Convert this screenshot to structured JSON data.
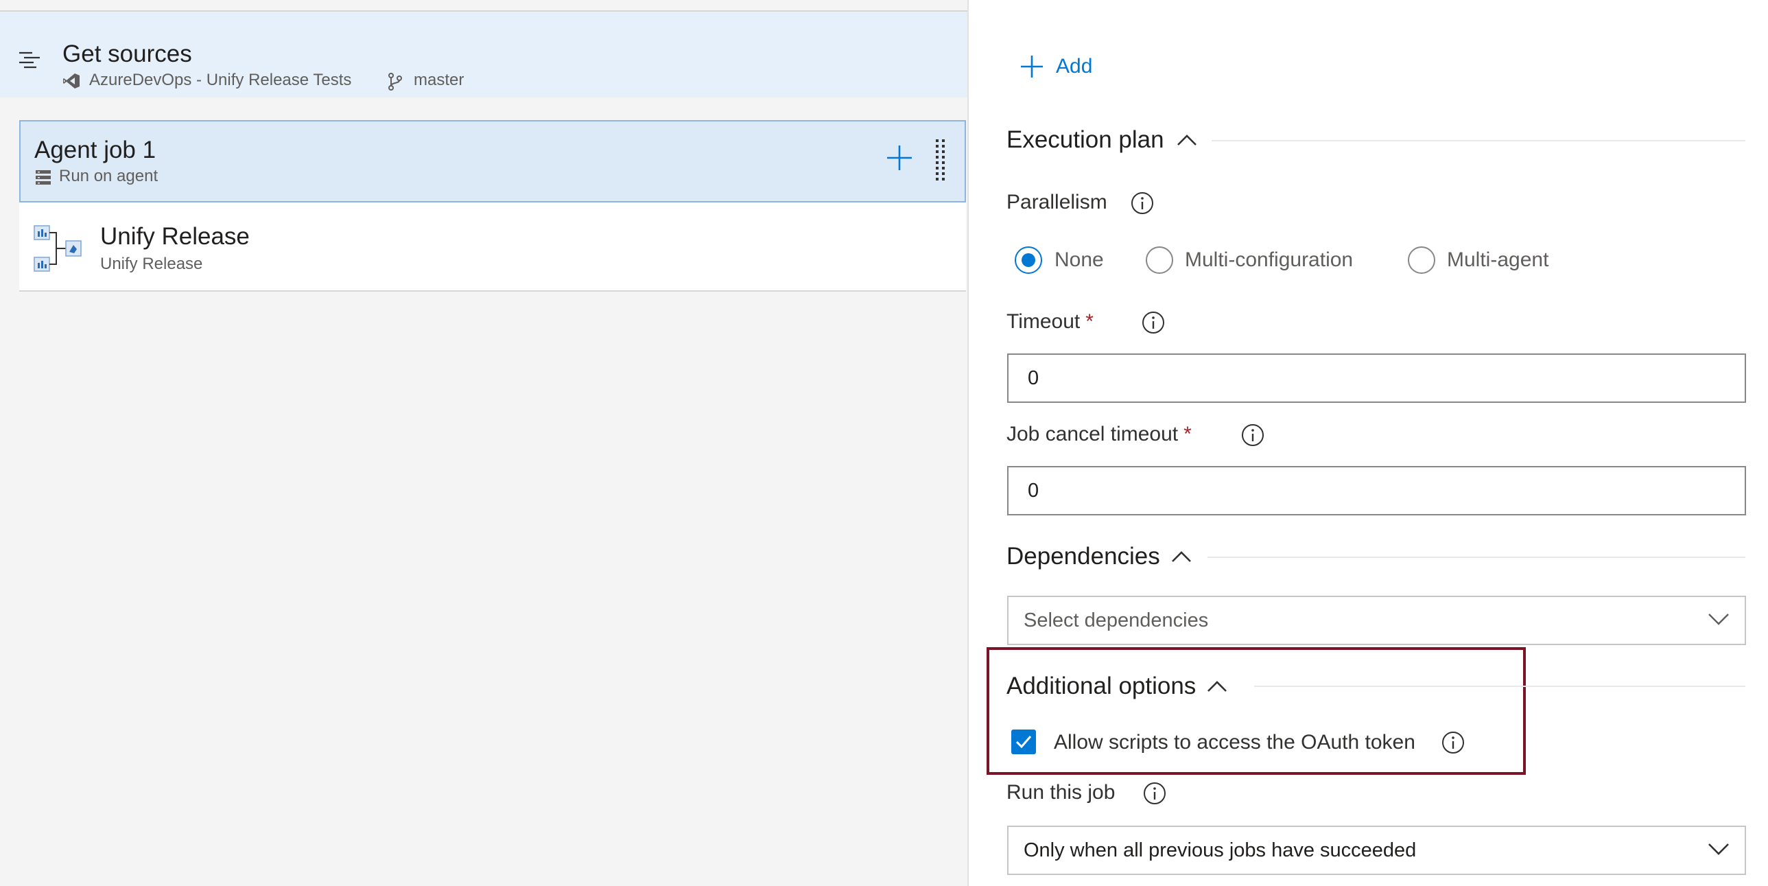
{
  "pipeline": {
    "get_sources": {
      "title": "Get sources",
      "repo": "AzureDevOps - Unify Release Tests",
      "branch": "master"
    },
    "agent_job": {
      "title": "Agent job 1",
      "subtitle": "Run on agent"
    },
    "task": {
      "title": "Unify Release",
      "subtitle": "Unify Release"
    }
  },
  "panel": {
    "add_label": "Add",
    "execution_plan": {
      "title": "Execution plan",
      "parallelism_label": "Parallelism",
      "options": [
        {
          "label": "None",
          "selected": true
        },
        {
          "label": "Multi-configuration",
          "selected": false
        },
        {
          "label": "Multi-agent",
          "selected": false
        }
      ],
      "timeout_label": "Timeout",
      "timeout_value": "0",
      "cancel_timeout_label": "Job cancel timeout",
      "cancel_timeout_value": "0",
      "required_marker": "*"
    },
    "dependencies": {
      "title": "Dependencies",
      "placeholder": "Select dependencies"
    },
    "additional_options": {
      "title": "Additional options",
      "oauth_label": "Allow scripts to access the OAuth token",
      "oauth_checked": true
    },
    "run_this_job": {
      "label": "Run this job",
      "value": "Only when all previous jobs have succeeded"
    }
  },
  "colors": {
    "accent": "#0078d4",
    "highlight_border": "#7a1426",
    "required": "#a4262c",
    "selected_row": "#dce9f7"
  },
  "icons": [
    "list-icon",
    "repo-icon",
    "branch-icon",
    "agent-icon",
    "add-icon",
    "drag-handle-icon",
    "task-icon",
    "chevron-up-icon",
    "chevron-down-icon",
    "info-icon",
    "checkbox-check-icon"
  ]
}
